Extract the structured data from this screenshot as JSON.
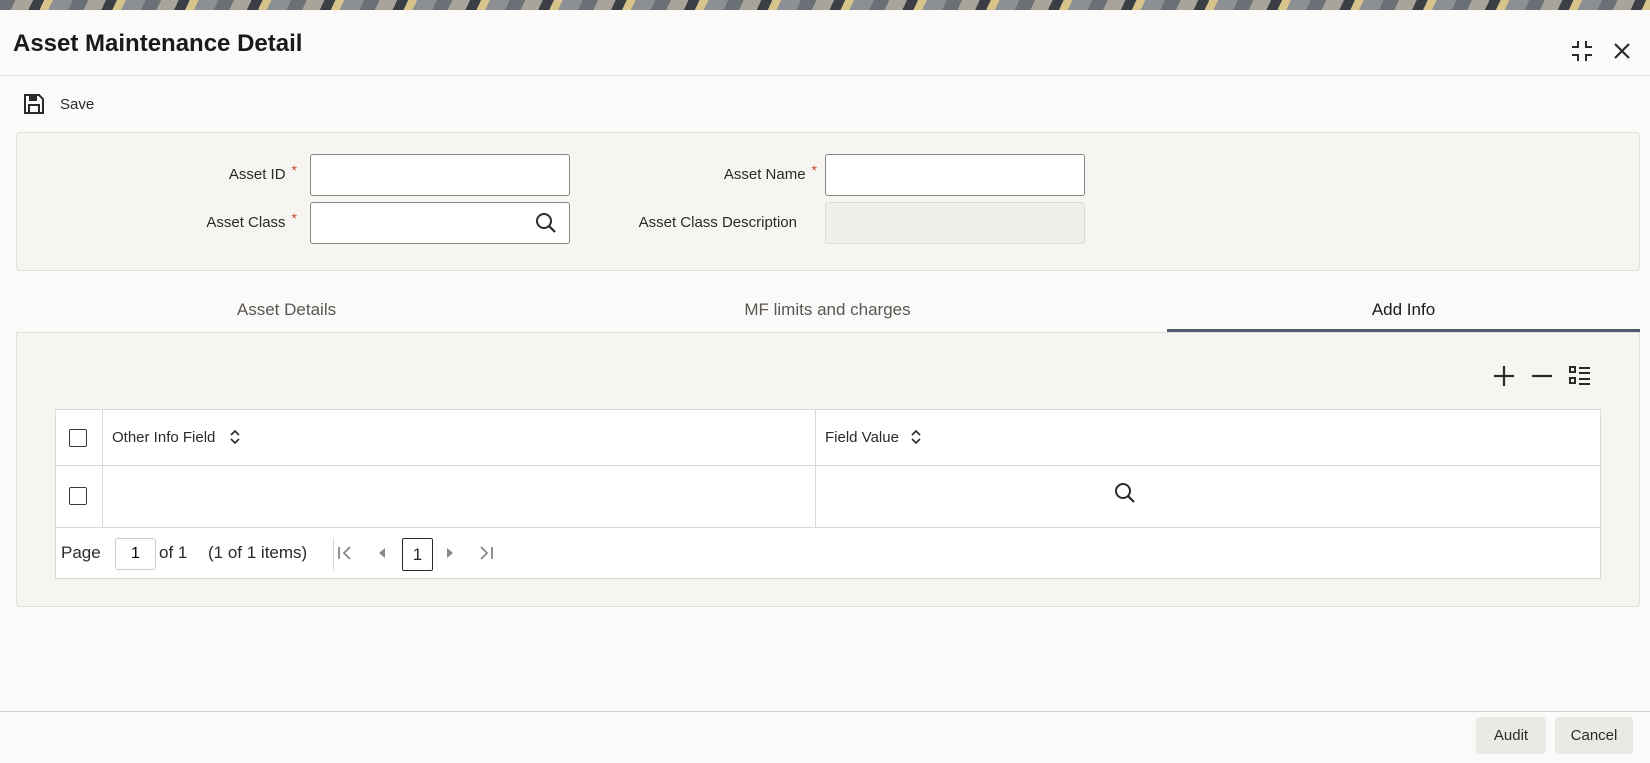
{
  "window": {
    "title": "Asset Maintenance Detail"
  },
  "toolbar": {
    "save_label": "Save"
  },
  "form": {
    "asset_id": {
      "label": "Asset ID",
      "required_mark": "*",
      "value": ""
    },
    "asset_name": {
      "label": "Asset Name",
      "required_mark": "*",
      "value": ""
    },
    "asset_class": {
      "label": "Asset Class",
      "required_mark": "*",
      "value": ""
    },
    "asset_class_description": {
      "label": "Asset Class Description",
      "value": ""
    }
  },
  "tabs": [
    {
      "label": "Asset Details",
      "active": false
    },
    {
      "label": "MF limits and charges",
      "active": false
    },
    {
      "label": "Add Info",
      "active": true
    }
  ],
  "grid": {
    "columns": [
      "Other Info Field",
      "Field Value"
    ],
    "rows": [
      {
        "other_info_field": "",
        "field_value": ""
      }
    ],
    "pager": {
      "page_label": "Page",
      "page_value": "1",
      "of_label": "of 1",
      "items_label": "(1 of 1 items)",
      "current_page": "1"
    }
  },
  "footer": {
    "audit_label": "Audit",
    "cancel_label": "Cancel"
  },
  "colors": {
    "accent": "#4f5a6e",
    "required": "#c74634",
    "panel": "#f6f5f2"
  }
}
